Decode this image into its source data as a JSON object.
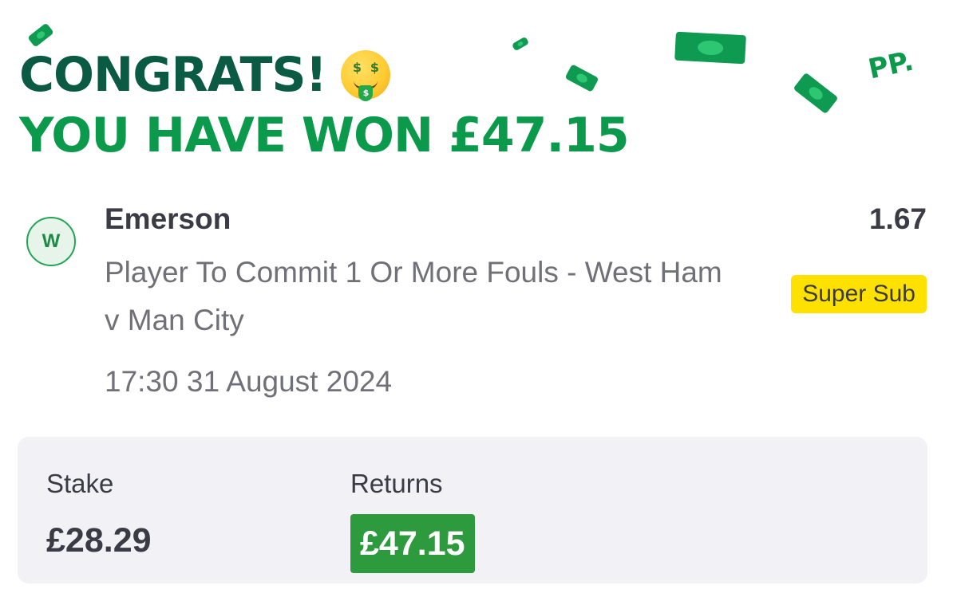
{
  "banner": {
    "line1": "CONGRATS!",
    "line2": "YOU HAVE WON £47.15",
    "emoji_icon": "money-mouth-face-icon",
    "logo": "PP."
  },
  "bet": {
    "result_badge": "W",
    "selection": "Emerson",
    "market": "Player To Commit 1 Or More Fouls - West Ham v Man City",
    "datetime": "17:30 31 August 2024",
    "odds": "1.67",
    "tag": "Super Sub"
  },
  "summary": {
    "stake_label": "Stake",
    "stake_value": "£28.29",
    "returns_label": "Returns",
    "returns_value": "£47.15"
  },
  "colors": {
    "dark_green": "#0b5a43",
    "brand_green": "#0b9a4c",
    "returns_green": "#2e9a3e",
    "tag_yellow": "#ffe100",
    "panel_bg": "#f1f1f6"
  }
}
